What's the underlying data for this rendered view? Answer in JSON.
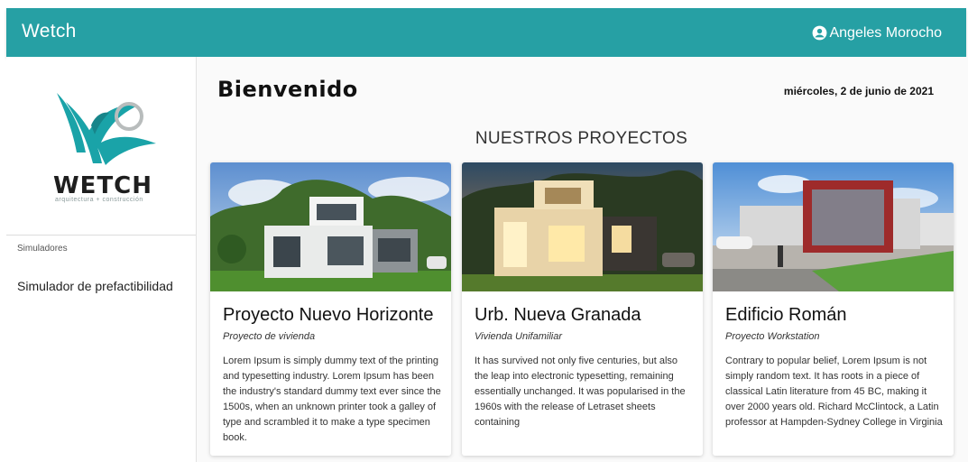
{
  "app": {
    "title": "Wetch"
  },
  "user": {
    "name": "Angeles Morocho",
    "icon": "account-circle-icon"
  },
  "colors": {
    "accent": "#26a0a4",
    "logo_teal": "#1aa3a8"
  },
  "sidebar": {
    "logo": {
      "text": "WETCH",
      "tagline": "arquitectura + construcción"
    },
    "section_label": "Simuladores",
    "items": [
      {
        "label": "Simulador de prefactibilidad"
      }
    ]
  },
  "main": {
    "welcome": "Bienvenido",
    "date": "miércoles, 2 de junio de 2021",
    "section_title": "NUESTROS PROYECTOS",
    "projects": [
      {
        "title": "Proyecto Nuevo Horizonte",
        "subtitle": "Proyecto de vivienda",
        "description": "Lorem Ipsum is simply dummy text of the printing and typesetting industry. Lorem Ipsum has been the industry's standard dummy text ever since the 1500s, when an unknown printer took a galley of type and scrambled it to make a type specimen book."
      },
      {
        "title": "Urb. Nueva Granada",
        "subtitle": "Vivienda Unifamiliar",
        "description": "It has survived not only five centuries, but also the leap into electronic typesetting, remaining essentially unchanged. It was popularised in the 1960s with the release of Letraset sheets containing"
      },
      {
        "title": "Edificio Román",
        "subtitle": "Proyecto Workstation",
        "description": "Contrary to popular belief, Lorem Ipsum is not simply random text. It has roots in a piece of classical Latin literature from 45 BC, making it over 2000 years old. Richard McClintock, a Latin professor at Hampden-Sydney College in Virginia"
      }
    ]
  }
}
